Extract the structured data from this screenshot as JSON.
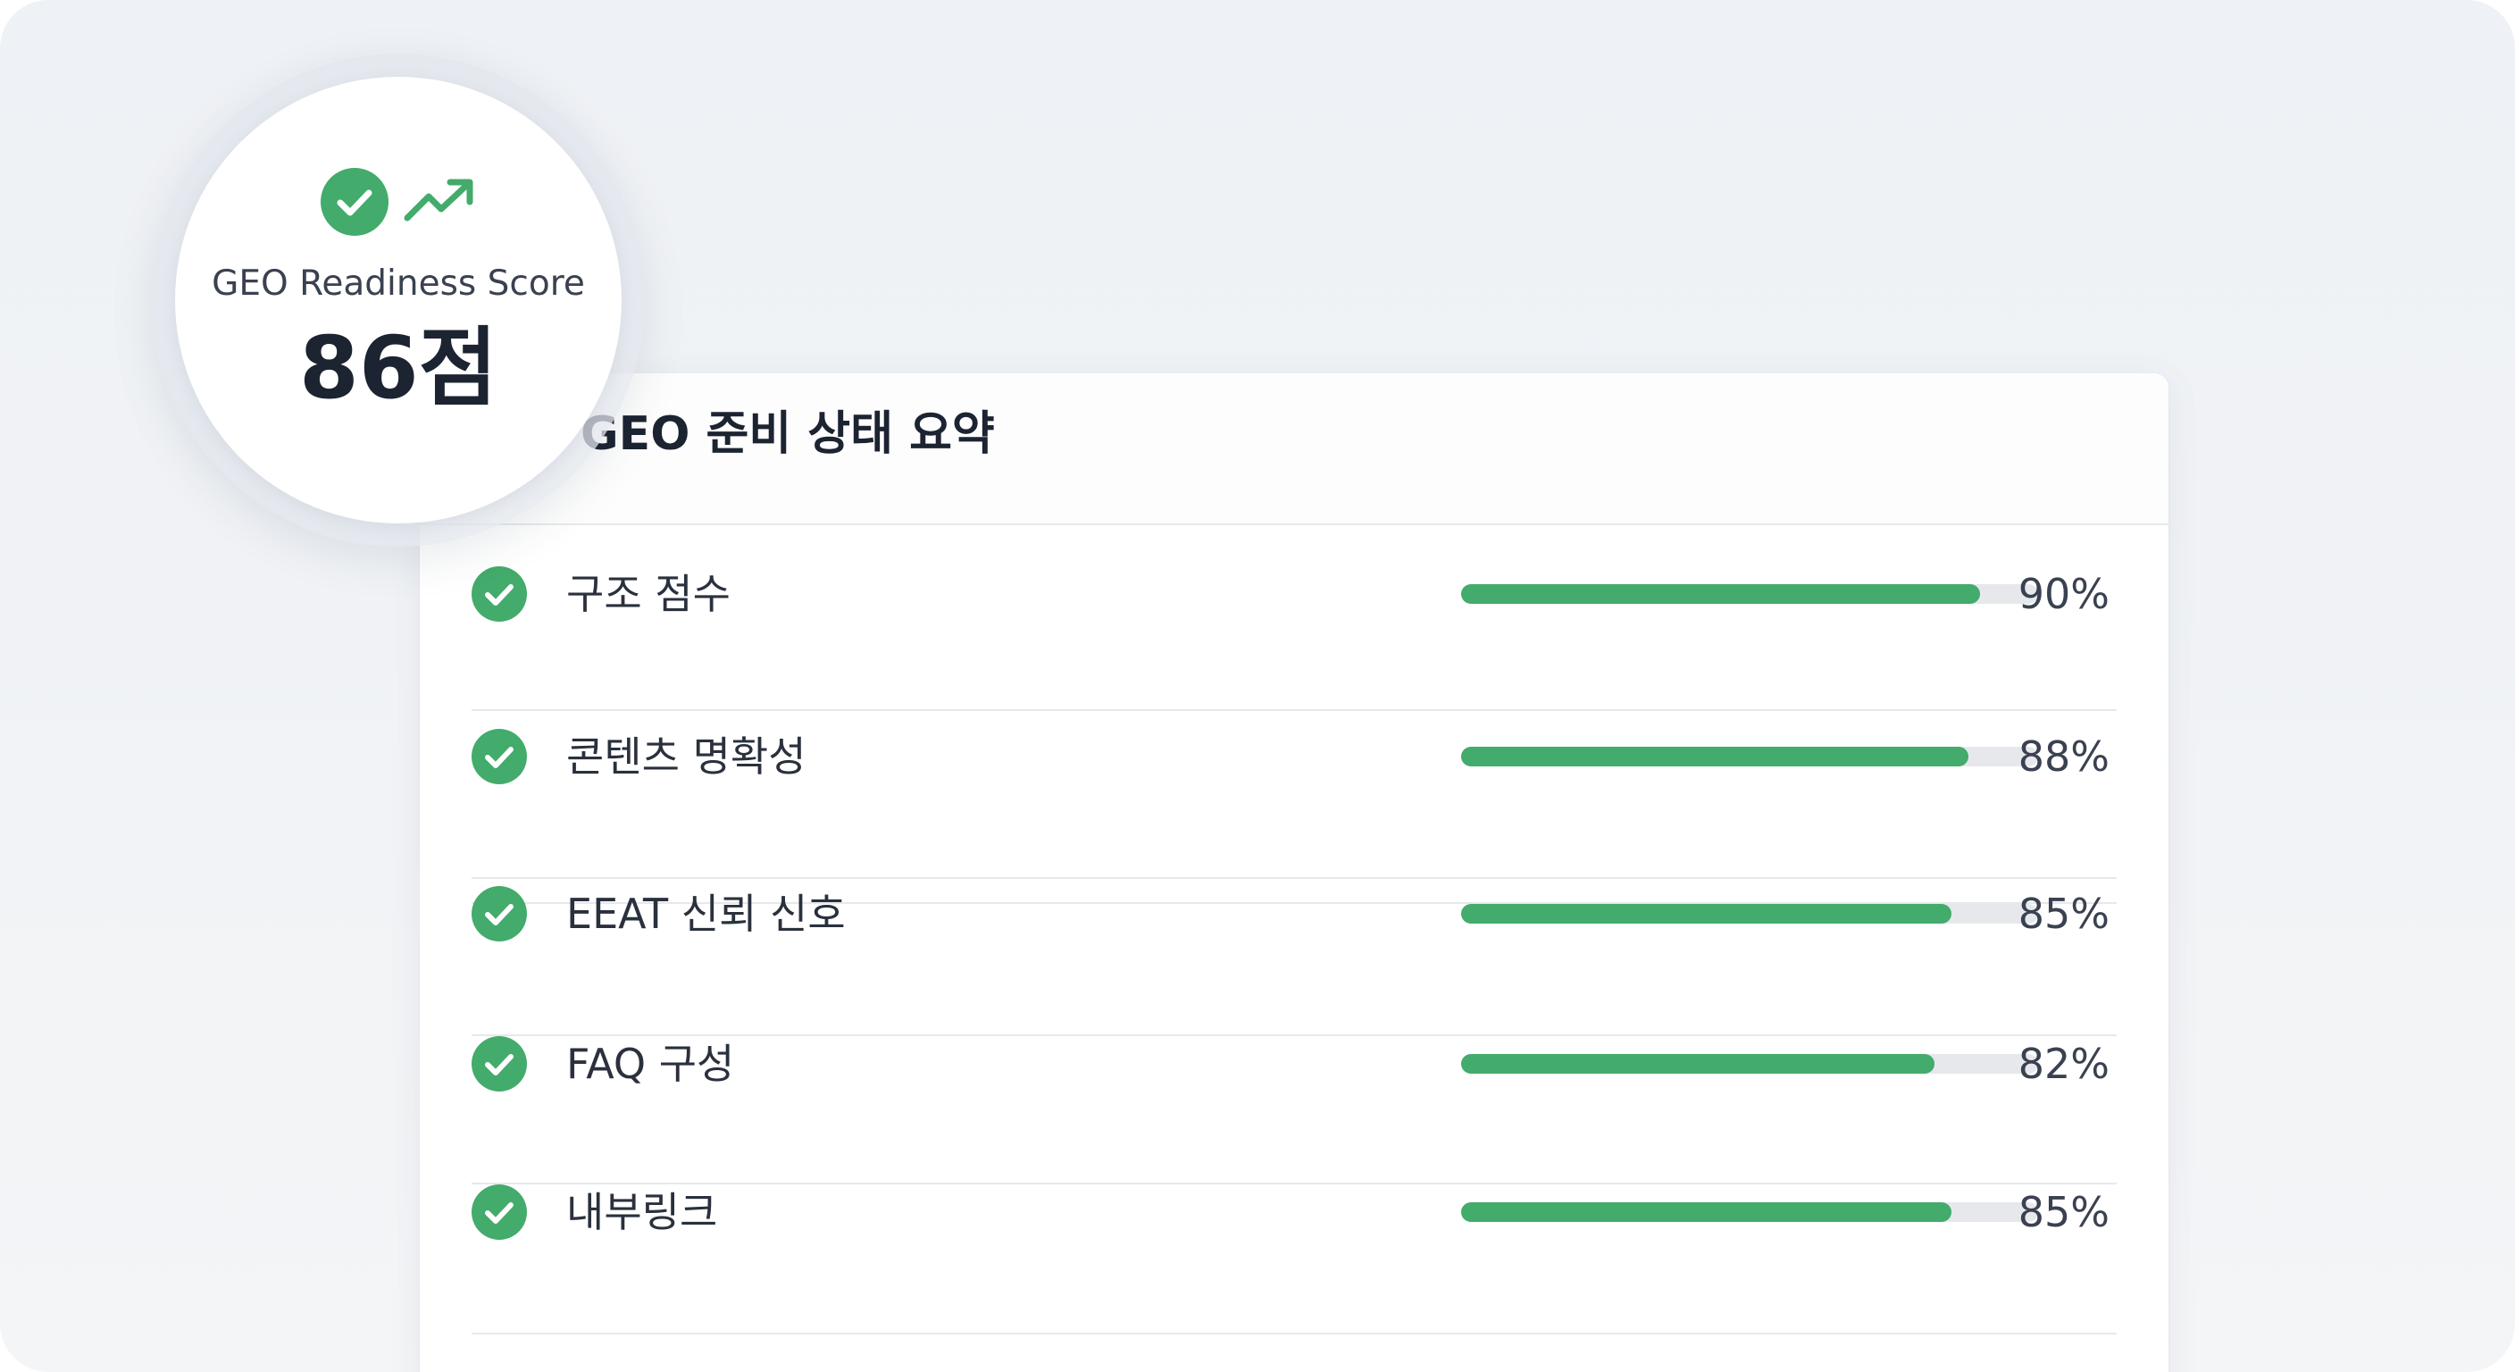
{
  "colors": {
    "accent_green": "#43ab6b",
    "track_gray": "#e6e8ec",
    "text_dark": "#1c2331"
  },
  "badge": {
    "icons": [
      "check-circle-icon",
      "trending-up-icon"
    ],
    "label": "GEO Readiness Score",
    "score": "86점"
  },
  "summary": {
    "title": "GEO 준비 상태 요약",
    "items": [
      {
        "icon": "check-circle-icon",
        "label": "구조 점수",
        "value": 90,
        "value_text": "90%"
      },
      {
        "icon": "check-circle-icon",
        "label": "콘텐츠 명확성",
        "value": 88,
        "value_text": "88%"
      },
      {
        "icon": "check-circle-icon",
        "label": "EEAT 신뢰 신호",
        "value": 85,
        "value_text": "85%"
      },
      {
        "icon": "check-circle-icon",
        "label": "FAQ 구성",
        "value": 82,
        "value_text": "82%"
      },
      {
        "icon": "check-circle-icon",
        "label": "내부링크",
        "value": 85,
        "value_text": "85%"
      }
    ]
  }
}
